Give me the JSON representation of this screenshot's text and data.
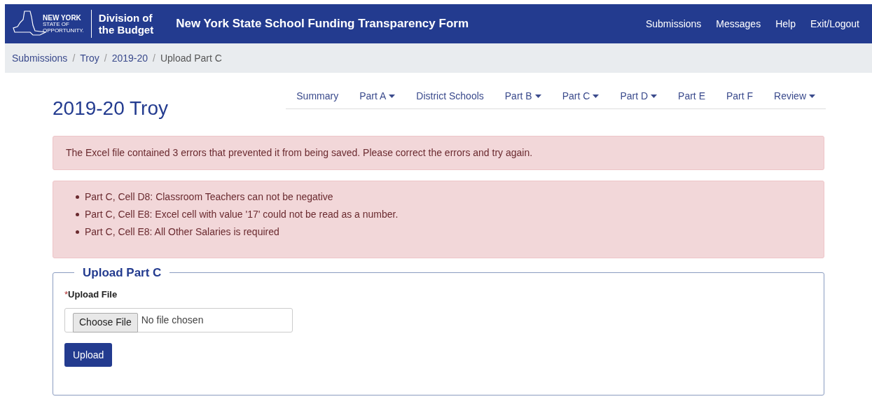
{
  "header": {
    "logo": {
      "line_1": "NEW YORK",
      "line_2": "STATE OF",
      "line_3": "OPPORTUNITY.",
      "division": "Division of",
      "budget": "the Budget"
    },
    "title": "New York State School Funding Transparency Form",
    "nav": [
      "Submissions",
      "Messages",
      "Help",
      "Exit/Logout"
    ]
  },
  "breadcrumb": [
    {
      "label": "Submissions"
    },
    {
      "separator": "/",
      "label": "Troy"
    },
    {
      "separator": "/",
      "label": "2019-20"
    },
    {
      "separator": "/",
      "label": "Upload Part C"
    }
  ],
  "page_title": "2019-20 Troy",
  "tabs": [
    {
      "label": "Summary",
      "dropdown": false
    },
    {
      "label": "Part A",
      "dropdown": true
    },
    {
      "label": "District Schools",
      "dropdown": false
    },
    {
      "label": "Part B",
      "dropdown": true
    },
    {
      "label": "Part C",
      "dropdown": true
    },
    {
      "label": "Part D",
      "dropdown": true
    },
    {
      "label": "Part E",
      "dropdown": false
    },
    {
      "label": "Part F",
      "dropdown": false
    },
    {
      "label": "Review",
      "dropdown": true
    }
  ],
  "alert": "The Excel file contained 3 errors that prevented it from being saved. Please correct the errors and try again.",
  "errors": [
    "Part C, Cell D8: Classroom Teachers can not be negative",
    "Part C, Cell E8: Excel cell with value '17' could not be read as a number.",
    "Part C, Cell E8: All Other Salaries is required"
  ],
  "upload": {
    "legend": "Upload Part C",
    "required_mark": "*",
    "label": "Upload File",
    "choose_button": "Choose File",
    "file_status": "No file chosen",
    "submit": "Upload"
  }
}
